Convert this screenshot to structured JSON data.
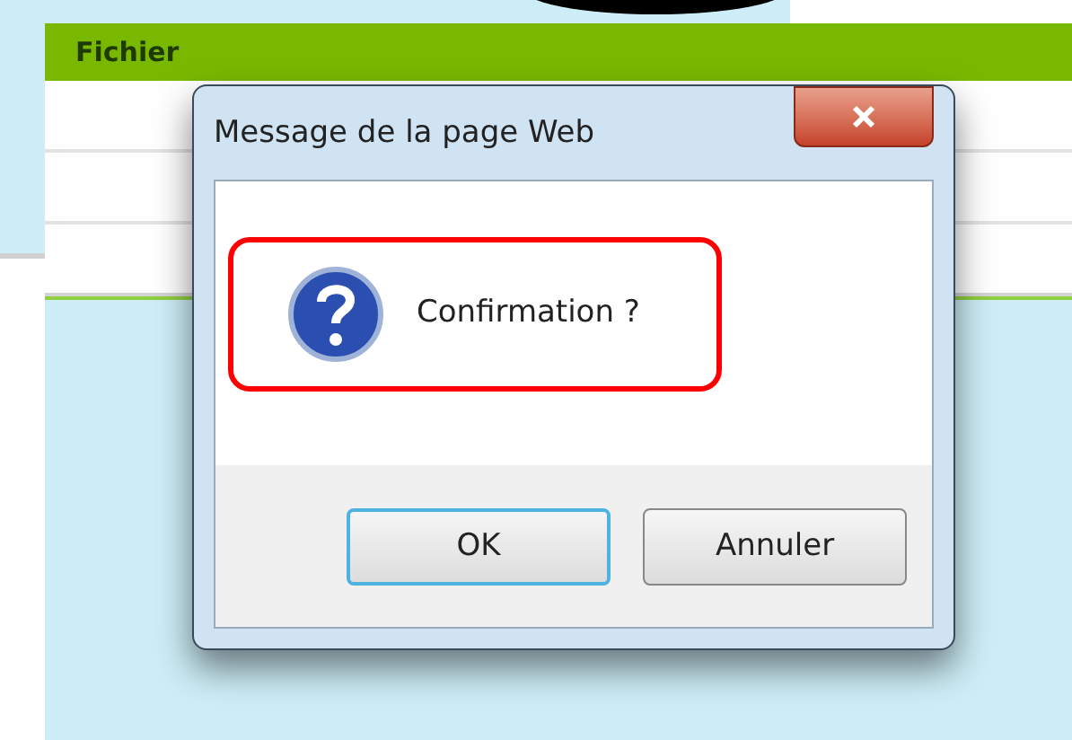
{
  "page": {
    "header": "Fichier"
  },
  "dialog": {
    "title": "Message de la page Web",
    "message": "Confirmation ?",
    "buttons": [
      {
        "label": "OK",
        "selected": true
      },
      {
        "label": "Annuler",
        "selected": false
      }
    ]
  }
}
